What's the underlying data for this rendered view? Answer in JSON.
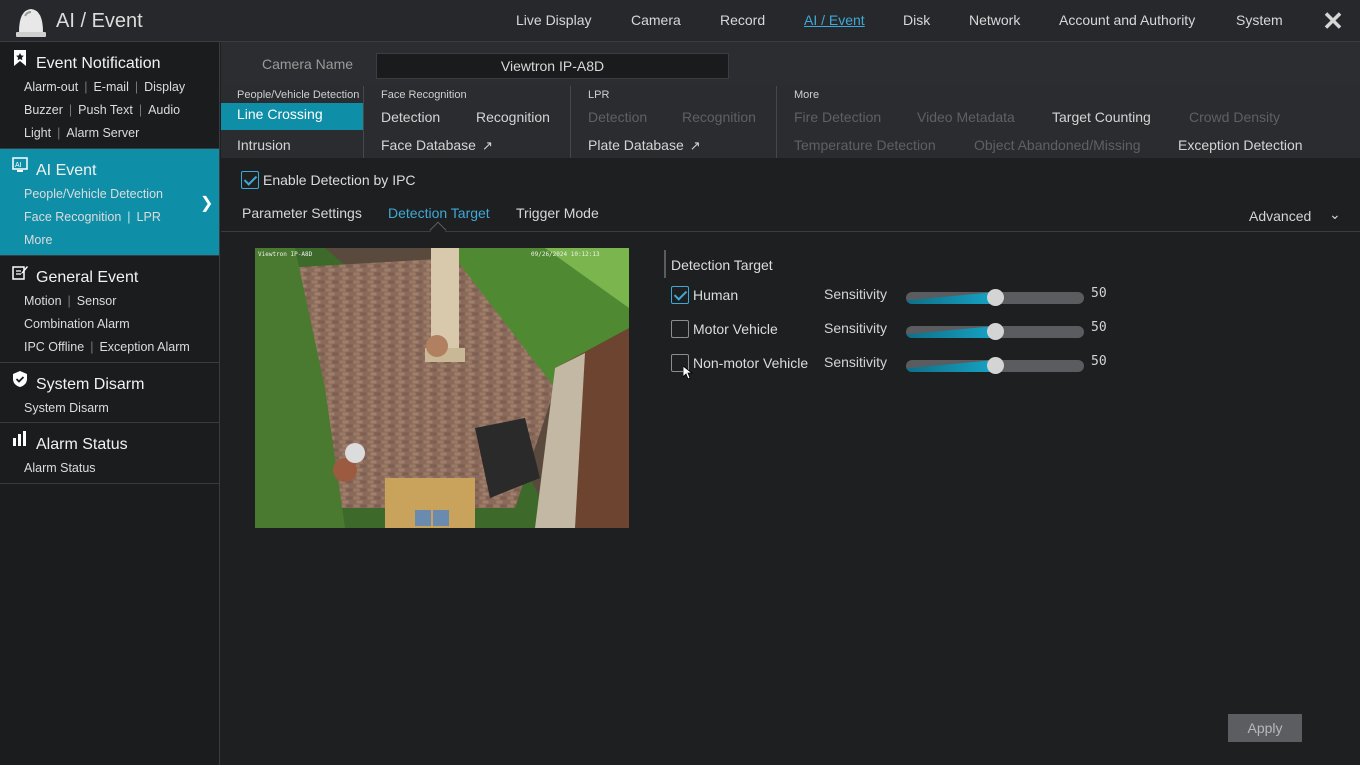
{
  "header": {
    "title": "AI / Event",
    "nav": [
      "Live Display",
      "Camera",
      "Record",
      "AI / Event",
      "Disk",
      "Network",
      "Account and Authority",
      "System"
    ],
    "active_nav": "AI / Event",
    "accent": "#3fa9d6"
  },
  "sidebar": {
    "sections": [
      {
        "title": "Event Notification",
        "icon": "bookmark-icon",
        "rows": [
          [
            "Alarm-out",
            "E-mail",
            "Display"
          ],
          [
            "Buzzer",
            "Push Text",
            "Audio"
          ],
          [
            "Light",
            "Alarm Server"
          ]
        ]
      },
      {
        "title": "AI Event",
        "icon": "ai-event-icon",
        "active": true,
        "rows": [
          [
            "People/Vehicle Detection"
          ],
          [
            "Face Recognition",
            "LPR"
          ],
          [
            "More"
          ]
        ]
      },
      {
        "title": "General Event",
        "icon": "general-event-icon",
        "rows": [
          [
            "Motion",
            "Sensor"
          ],
          [
            "Combination Alarm"
          ],
          [
            "IPC Offline",
            "Exception Alarm"
          ]
        ]
      },
      {
        "title": "System Disarm",
        "icon": "shield-icon",
        "rows": [
          [
            "System Disarm"
          ]
        ]
      },
      {
        "title": "Alarm Status",
        "icon": "alarm-status-icon",
        "rows": [
          [
            "Alarm Status"
          ]
        ]
      }
    ],
    "active_color": "#0f8ea8"
  },
  "camera": {
    "label": "Camera Name",
    "value": "Viewtron IP-A8D"
  },
  "categories": {
    "people": {
      "head": "People/Vehicle Detection",
      "items": [
        "Line Crossing",
        "Intrusion"
      ]
    },
    "face": {
      "head": "Face Recognition",
      "items": [
        "Detection",
        "Recognition",
        "Face Database"
      ]
    },
    "lpr": {
      "head": "LPR",
      "items": [
        "Detection",
        "Recognition",
        "Plate Database"
      ]
    },
    "more": {
      "head": "More",
      "items": [
        "Fire Detection",
        "Video Metadata",
        "Target Counting",
        "Crowd Density",
        "Temperature Detection",
        "Object Abandoned/Missing",
        "Exception Detection"
      ]
    }
  },
  "enable": {
    "label": "Enable Detection by IPC",
    "checked": true
  },
  "tabs": [
    "Parameter Settings",
    "Detection Target",
    "Trigger Mode"
  ],
  "active_tab": "Detection Target",
  "advanced": "Advanced",
  "preview": {
    "osd_name": "Viewtron IP-A8D",
    "osd_time": "09/26/2024 10:12:13"
  },
  "detection_target": {
    "title": "Detection Target",
    "targets": [
      {
        "label": "Human",
        "checked": true,
        "sensitivity_label": "Sensitivity",
        "sensitivity": 50
      },
      {
        "label": "Motor Vehicle",
        "checked": false,
        "sensitivity_label": "Sensitivity",
        "sensitivity": 50
      },
      {
        "label": "Non-motor Vehicle",
        "checked": false,
        "sensitivity_label": "Sensitivity",
        "sensitivity": 50
      }
    ]
  },
  "apply": "Apply"
}
